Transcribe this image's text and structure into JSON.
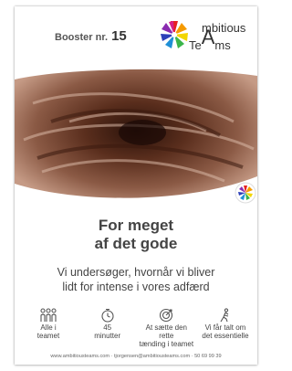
{
  "header": {
    "booster_label": "Booster nr.",
    "booster_number": "15"
  },
  "logo": {
    "line1": "mbitious",
    "line2": "Te",
    "line2_big": "A",
    "line2_end": "ms"
  },
  "title": {
    "line1": "For meget",
    "line2": "af det gode"
  },
  "subtitle": {
    "line1": "Vi undersøger, hvornår vi bliver",
    "line2": "lidt for intense i vores adfærd"
  },
  "features": [
    {
      "icon": "team-icon",
      "line1": "Alle i",
      "line2": "teamet"
    },
    {
      "icon": "stopwatch-icon",
      "line1": "45",
      "line2": "minutter"
    },
    {
      "icon": "target-icon",
      "line1": "At sætte den rette",
      "line2": "tænding i teamet"
    },
    {
      "icon": "walking-person-icon",
      "line1": "Vi får talt om",
      "line2": "det essentielle"
    }
  ],
  "footer": "www.ambitiousteams.com · tjorgensen@ambitiousteams.com · 50 69 99 39"
}
